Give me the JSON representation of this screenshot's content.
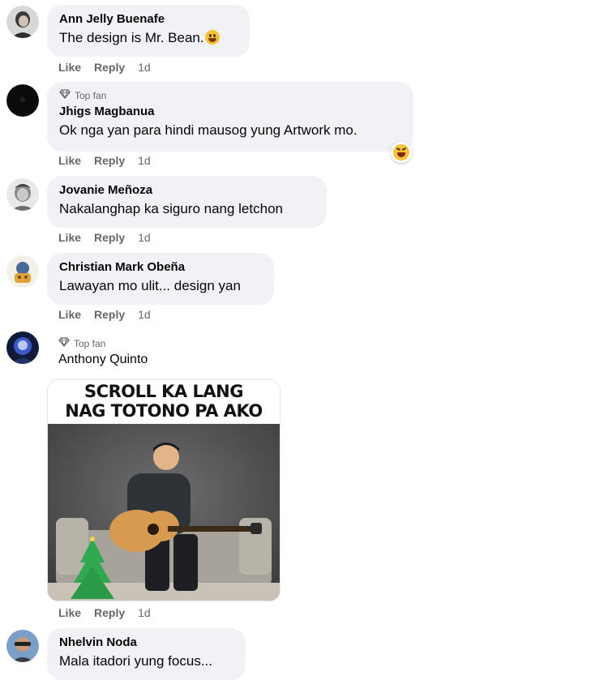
{
  "actions": {
    "like": "Like",
    "reply": "Reply"
  },
  "comments": [
    {
      "name": "Ann Jelly Buenafe",
      "text": "The design is Mr. Bean.",
      "time": "1d",
      "top_fan": false
    },
    {
      "name": "Jhigs Magbanua",
      "text": "Ok nga yan para hindi mausog yung Artwork mo.",
      "time": "1d",
      "top_fan": true,
      "badge": "Top fan"
    },
    {
      "name": "Jovanie Meñoza",
      "text": "Nakalanghap ka siguro nang letchon",
      "time": "1d",
      "top_fan": false
    },
    {
      "name": "Christian Mark Obeña",
      "text": "Lawayan mo ulit... design yan",
      "time": "1d",
      "top_fan": false
    },
    {
      "name": "Anthony Quinto",
      "text": "",
      "time": "1d",
      "top_fan": true,
      "badge": "Top fan",
      "meme": {
        "line1": "SCROLL KA LANG",
        "line2": "NAG TOTONO PA AKO"
      }
    },
    {
      "name": "Nhelvin Noda",
      "text": "Mala itadori yung focus...",
      "time": "",
      "top_fan": false
    }
  ],
  "icons": {
    "badge": "diamond-icon",
    "emoji_laugh": "grinning-sweat-emoji",
    "reaction": "haha-reaction-icon"
  }
}
